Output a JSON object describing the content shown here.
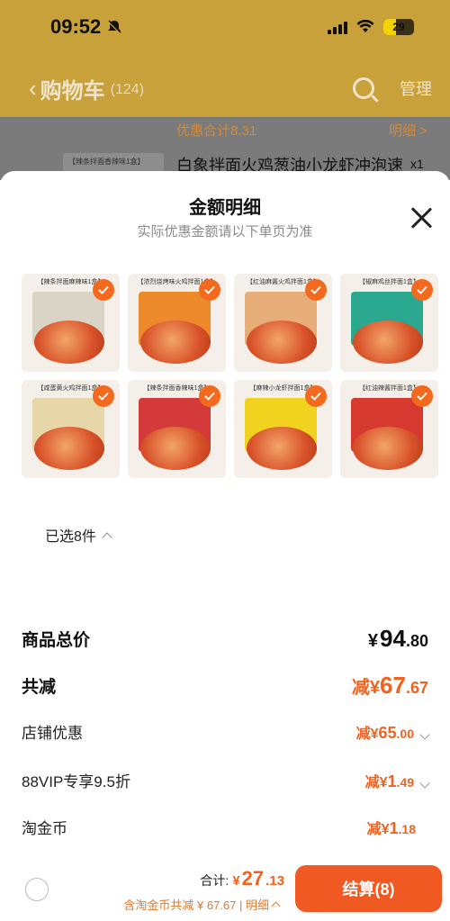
{
  "status_bar": {
    "time": "09:52",
    "battery": "29"
  },
  "nav": {
    "back_icon": "chevron-left-icon",
    "title": "购物车",
    "count": "(124)",
    "manage": "管理"
  },
  "bg_strip": {
    "discount_total": "优惠合计8.31",
    "detail": "明细 >",
    "thumb_label": "【辣条拌面香辣味1盒】",
    "product_name": "白象拌面火鸡葱油小龙虾冲泡速",
    "qty": "x1"
  },
  "sheet": {
    "title": "金额明细",
    "subtitle": "实际优惠金额请以下单页为准"
  },
  "products": [
    {
      "label": "【辣条拌面麻辣味1盒】",
      "box": "#d9d4c6"
    },
    {
      "label": "【浓烈烧烤味火鸡拌面1盒】",
      "box": "#ec8a2c"
    },
    {
      "label": "【红油麻酱火鸡拌面1盒】",
      "box": "#e7ae7a"
    },
    {
      "label": "【椒麻鸡丝拌面1盒】",
      "box": "#2aa890"
    },
    {
      "label": "【咸蛋黄火鸡拌面1盒】",
      "box": "#e7d7a8"
    },
    {
      "label": "【辣条拌面香辣味1盒】",
      "box": "#d43a3a"
    },
    {
      "label": "【麻辣小龙虾拌面1盒】",
      "box": "#f1d21f"
    },
    {
      "label": "【红油辣酱拌面1盒】",
      "box": "#d63a2e"
    }
  ],
  "selected": {
    "text": "已选8件"
  },
  "breakdown": {
    "total": {
      "label": "商品总价",
      "cur": "¥",
      "int": "94",
      "dec": ".80"
    },
    "reduce": {
      "label": "共减",
      "pre": "减¥",
      "int": "67",
      "dec": ".67"
    },
    "shop": {
      "label": "店铺优惠",
      "pre": "减¥",
      "int": "65",
      "dec": ".00"
    },
    "vip": {
      "label": "88VIP专享9.5折",
      "pre": "减¥",
      "int": "1",
      "dec": ".49"
    },
    "coin": {
      "label": "淘金币",
      "pre": "减¥",
      "int": "1",
      "dec": ".18"
    }
  },
  "bottom": {
    "sum_label": "合计:",
    "cur": "¥",
    "int": "27",
    "dec": ".13",
    "note": "含淘金币共减 ¥ 67.67 | 明细",
    "checkout": "结算(8)"
  },
  "colors": {
    "accent": "#f05a22",
    "price_orange": "#f3621e",
    "check_orange": "#f36a1f"
  }
}
